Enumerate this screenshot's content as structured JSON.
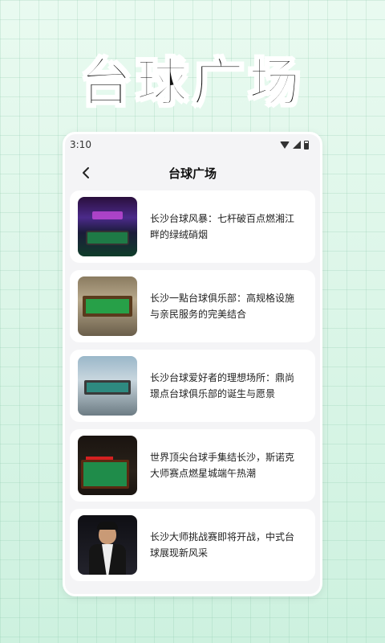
{
  "banner": {
    "title": "台球广场"
  },
  "status_bar": {
    "time": "3:10",
    "icons": [
      "wifi-icon",
      "signal-icon",
      "battery-icon"
    ]
  },
  "appbar": {
    "title": "台球广场",
    "back_icon": "chevron-left-icon"
  },
  "articles": [
    {
      "title_line1": "长沙台球风暴：七杆破百点燃湘江",
      "title_line2": "畔的绿绒硝烟"
    },
    {
      "title_line1": "长沙一點台球俱乐部：高规格设施",
      "title_line2": "与亲民服务的完美结合"
    },
    {
      "title_line1": "长沙台球爱好者的理想场所：鼎尚",
      "title_line2": "璟点台球俱乐部的诞生与愿景"
    },
    {
      "title_line1": "世界顶尖台球手集结长沙，斯诺克",
      "title_line2": "大师赛点燃星城端午热潮"
    },
    {
      "title_line1": "长沙大师挑战赛即将开战，中式台",
      "title_line2": "球展现新风采"
    }
  ],
  "colors": {
    "accent_bg": "#dcf5e8",
    "card_bg": "#ffffff",
    "phone_bg": "#f4f4f6"
  }
}
